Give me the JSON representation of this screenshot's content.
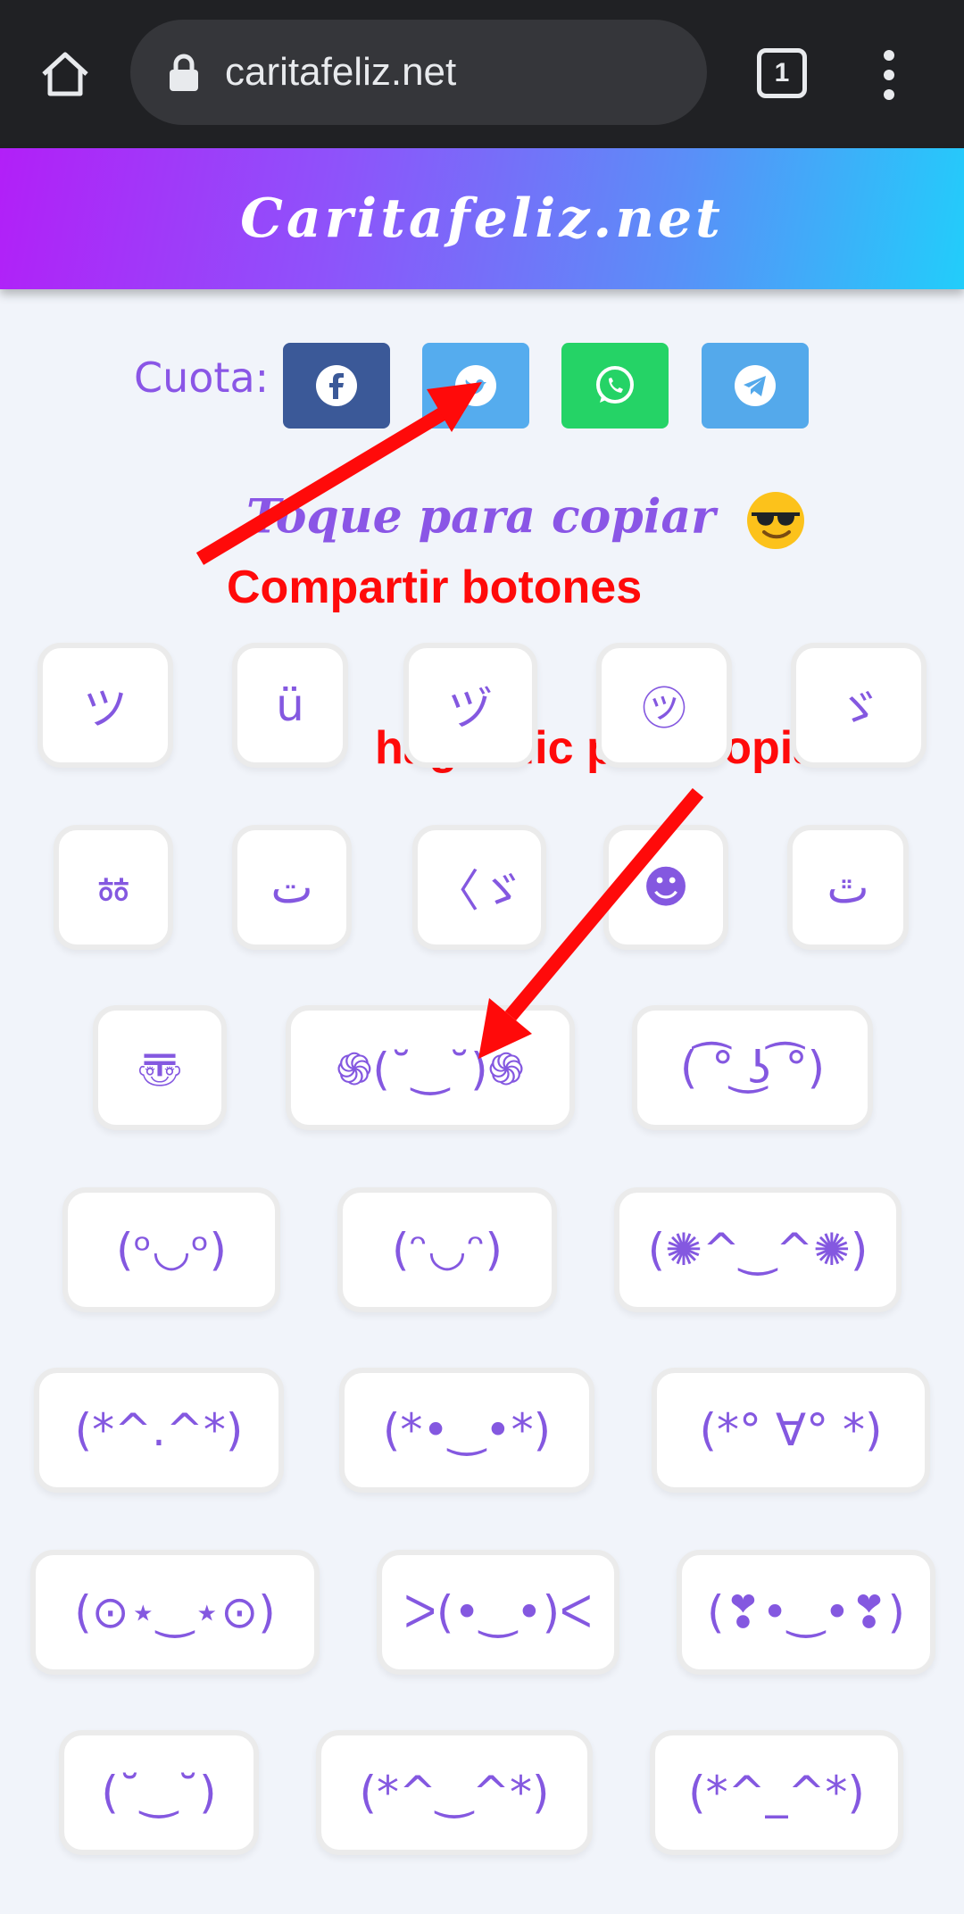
{
  "browser": {
    "url": "caritafeliz.net",
    "tab_count": "1"
  },
  "site": {
    "title": "Caritafeliz.net"
  },
  "share": {
    "label": "Cuota:",
    "buttons": [
      {
        "name": "facebook",
        "color": "#3b5998"
      },
      {
        "name": "twitter",
        "color": "#55acee"
      },
      {
        "name": "whatsapp",
        "color": "#25d366"
      },
      {
        "name": "telegram",
        "color": "#54a9eb"
      }
    ]
  },
  "heading": "Toque para copiar",
  "annotations": {
    "share_note": "Compartir botones",
    "copy_note": "haga clic para copiar",
    "arrow_color": "#ff0a0a"
  },
  "kaomoji": [
    "ツ",
    "ü",
    "ヅ",
    "㋡",
    "ゞ",
    "ㆅ",
    "ت",
    "〈ゞ",
    "☻",
    "ٿ",
    "〠",
    "֍(˘‿˘)֍",
    "( ͡° ͜ʖ ͡°)",
    "(ᵒ◡ᵒ)",
    "(ᵔ◡ᵔ)",
    "(✺^‿^✺)",
    "(*^.^*)",
    "(*•‿•*)",
    "(*° ∀° *)",
    "(⊙⋆‿⋆⊙)",
    "ᐳ(•‿•)ᐸ",
    "(❣•‿•❣)",
    "(˘‿˘)",
    "(*^‿^*)",
    "(*^_^*)"
  ]
}
